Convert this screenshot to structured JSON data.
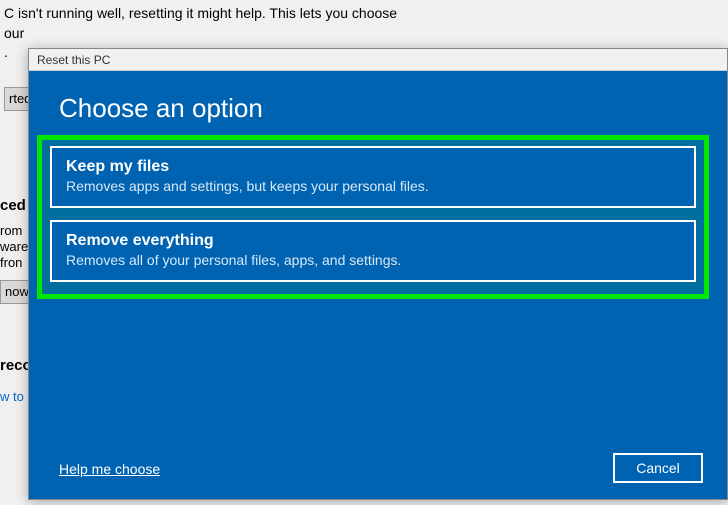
{
  "background": {
    "line1": "C isn't running well, resetting it might help. This lets you choose",
    "line2": "our",
    "line3": ".",
    "button_rted": "rted",
    "ced": "ced",
    "from": "rom",
    "ware": "ware",
    "fron": " fron",
    "button_now": " now",
    "reco": "reco",
    "wto": "w to"
  },
  "dialog": {
    "title": "Reset this PC",
    "heading": "Choose an option",
    "options": [
      {
        "title": "Keep my files",
        "desc": "Removes apps and settings, but keeps your personal files."
      },
      {
        "title": "Remove everything",
        "desc": "Removes all of your personal files, apps, and settings."
      }
    ],
    "help_link": "Help me choose",
    "cancel": "Cancel"
  }
}
